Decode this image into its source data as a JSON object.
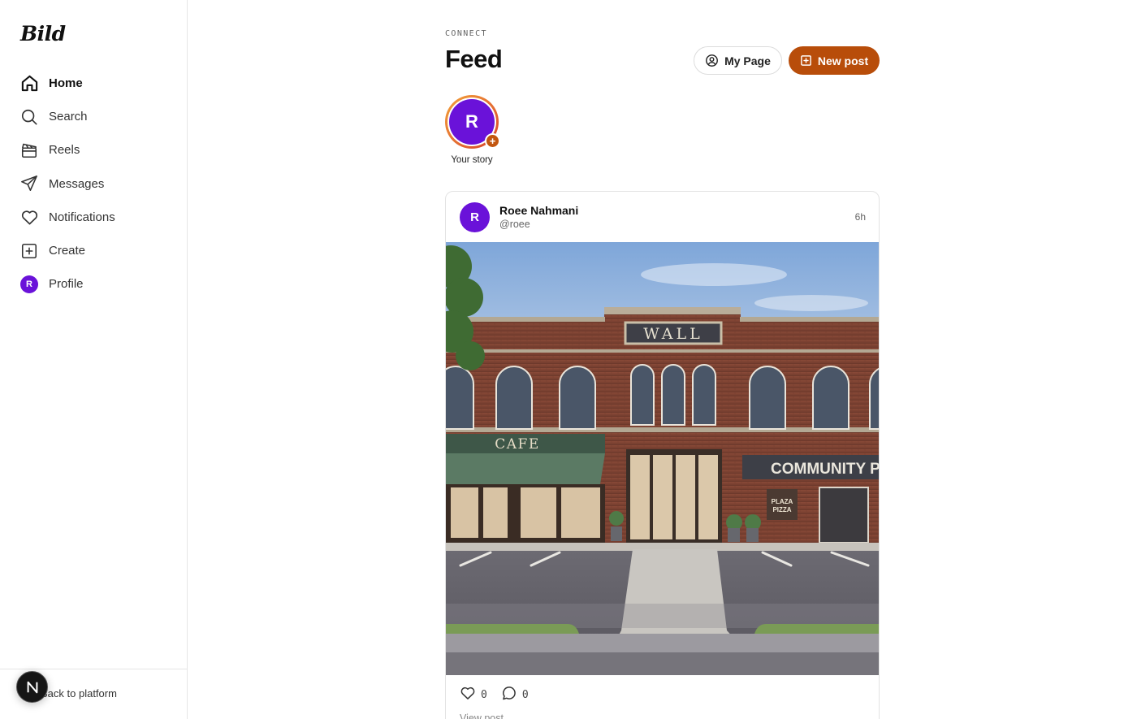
{
  "app": {
    "brand": "Bild"
  },
  "sidebar": {
    "items": [
      {
        "label": "Home",
        "icon": "home-icon",
        "active": true
      },
      {
        "label": "Search",
        "icon": "search-icon"
      },
      {
        "label": "Reels",
        "icon": "clapperboard-icon"
      },
      {
        "label": "Messages",
        "icon": "send-icon"
      },
      {
        "label": "Notifications",
        "icon": "heart-icon"
      },
      {
        "label": "Create",
        "icon": "plus-square-icon"
      },
      {
        "label": "Profile",
        "icon": "avatar",
        "avatar_initial": "R"
      }
    ],
    "back_label": "Back to platform",
    "badge_letter": "N"
  },
  "header": {
    "eyebrow": "CONNECT",
    "title": "Feed",
    "my_page_label": "My Page",
    "new_post_label": "New post"
  },
  "stories": [
    {
      "initial": "R",
      "label": "Your story"
    }
  ],
  "post": {
    "author": "Roee Nahmani",
    "handle": "@roee",
    "avatar_initial": "R",
    "time": "6h",
    "likes": "0",
    "comments": "0",
    "view_label": "View post",
    "image": {
      "building_sign": "WALL",
      "awning_sign": "CAFE",
      "store_sign": "COMMUNITY PIZZ",
      "logo_lines": [
        "PLAZA",
        "PIZZA"
      ]
    }
  },
  "colors": {
    "accent": "#b84d0a",
    "avatar": "#6a12d9",
    "border": "#e3e3e3"
  }
}
